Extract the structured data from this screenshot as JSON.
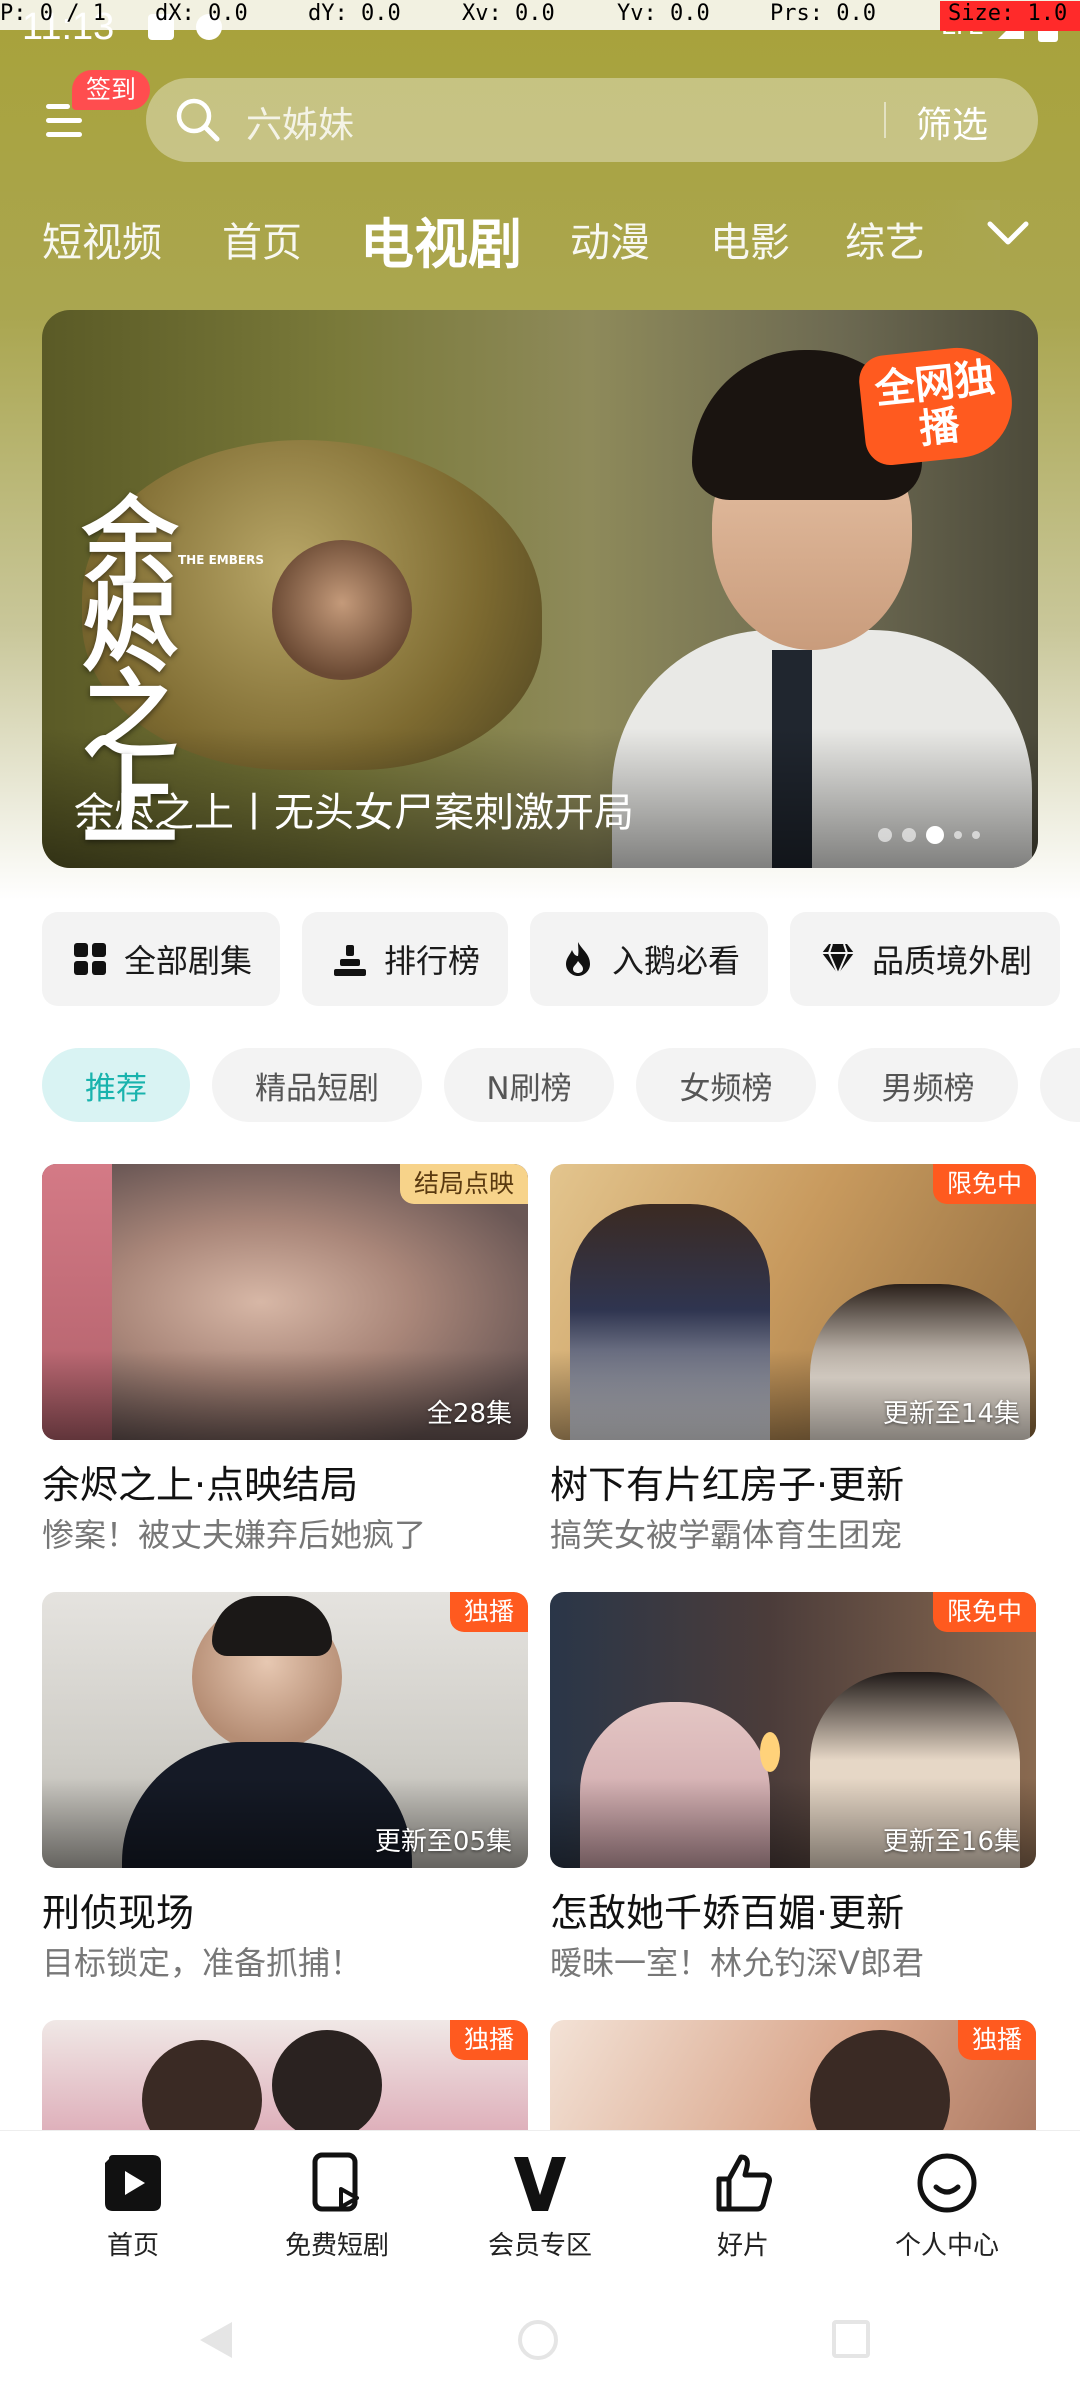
{
  "debug": {
    "pointer": "P: 0 / 1",
    "dx": "dX: 0.0",
    "dy": "dY: 0.0",
    "xv": "Xv: 0.0",
    "yv": "Yv: 0.0",
    "prs": "Prs: 0.0",
    "size": "Size: 1.0"
  },
  "status": {
    "time": "11:13",
    "network": "LTE"
  },
  "header": {
    "checkin_badge": "签到",
    "search_placeholder": "六姊妹",
    "filter_label": "筛选"
  },
  "nav": {
    "tabs": [
      {
        "label": "短视频",
        "active": false
      },
      {
        "label": "首页",
        "active": false
      },
      {
        "label": "电视剧",
        "active": true
      },
      {
        "label": "动漫",
        "active": false
      },
      {
        "label": "电影",
        "active": false
      },
      {
        "label": "综艺",
        "active": false
      }
    ]
  },
  "banner": {
    "logo_text": "余烬之上",
    "logo_sub": "THE EMBERS",
    "badge": "全网独播",
    "title": "余烬之上丨无头女尸案刺激开局",
    "dots": 5,
    "active_dot": 2
  },
  "quick_entries": [
    {
      "label": "全部剧集",
      "icon": "grid-icon"
    },
    {
      "label": "排行榜",
      "icon": "podium-icon"
    },
    {
      "label": "入鹅必看",
      "icon": "flame-icon"
    },
    {
      "label": "品质境外剧",
      "icon": "diamond-icon"
    }
  ],
  "chips": [
    {
      "label": "推荐",
      "active": true
    },
    {
      "label": "精品短剧",
      "active": false
    },
    {
      "label": "N刷榜",
      "active": false
    },
    {
      "label": "女频榜",
      "active": false
    },
    {
      "label": "男频榜",
      "active": false
    }
  ],
  "cards": [
    {
      "title": "余烬之上·点映结局",
      "subtitle": "惨案！被丈夫嫌弃后她疯了",
      "tag": "结局点映",
      "tag_style": "gold",
      "episodes": "全28集"
    },
    {
      "title": "树下有片红房子·更新",
      "subtitle": "搞笑女被学霸体育生团宠",
      "tag": "限免中",
      "tag_style": "orange",
      "episodes": "更新至14集"
    },
    {
      "title": "刑侦现场",
      "subtitle": "目标锁定，准备抓捕！",
      "tag": "独播",
      "tag_style": "orange",
      "episodes": "更新至05集"
    },
    {
      "title": "怎敌她千娇百媚·更新",
      "subtitle": "暧昧一室！林允钓深V郎君",
      "tag": "限免中",
      "tag_style": "orange",
      "episodes": "更新至16集"
    },
    {
      "title": "",
      "subtitle": "",
      "tag": "独播",
      "tag_style": "orange",
      "episodes": ""
    },
    {
      "title": "",
      "subtitle": "",
      "tag": "独播",
      "tag_style": "orange",
      "episodes": ""
    }
  ],
  "tabbar": [
    {
      "label": "首页",
      "icon": "play-icon",
      "active": true
    },
    {
      "label": "免费短剧",
      "icon": "phone-play-icon",
      "active": false
    },
    {
      "label": "会员专区",
      "icon": "vip-v-icon",
      "active": false
    },
    {
      "label": "好片",
      "icon": "thumbs-up-icon",
      "active": false
    },
    {
      "label": "个人中心",
      "icon": "smile-icon",
      "active": false
    }
  ],
  "colors": {
    "accent_teal": "#19b3ad",
    "badge_red": "#ff4d4f",
    "tag_orange": "#ff5a1f",
    "tag_gold": "#f7d38a"
  }
}
